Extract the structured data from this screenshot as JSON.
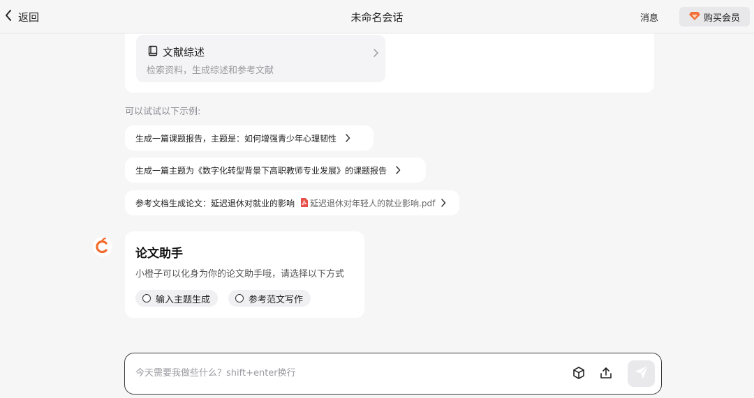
{
  "header": {
    "back_label": "返回",
    "title": "未命名会话",
    "messages_label": "消息",
    "vip_label": "购买会员"
  },
  "colors": {
    "accent": "#f26b2b",
    "vip": "#f1703a",
    "pdf": "#e8504a",
    "background": "#f6f6f7"
  },
  "literature": {
    "title": "文献综述",
    "subtitle": "检索资料，生成综述和参考文献",
    "icon": "book-icon"
  },
  "examples": {
    "label": "可以试试以下示例:",
    "items": [
      {
        "text": "生成一篇课题报告，主题是：如何增强青少年心理韧性"
      },
      {
        "text": "生成一篇主题为《数字化转型背景下高职教师专业发展》的课题报告"
      },
      {
        "text": "参考文档生成论文：延迟退休对就业的影响",
        "attachment": "延迟退休对年轻人的就业影响.pdf"
      }
    ]
  },
  "assistant": {
    "title": "论文助手",
    "description": "小橙子可以化身为你的论文助手哦，请选择以下方式",
    "options": [
      "输入主题生成",
      "参考范文写作"
    ]
  },
  "input": {
    "placeholder": "今天需要我做些什么？shift+enter换行",
    "value": ""
  }
}
